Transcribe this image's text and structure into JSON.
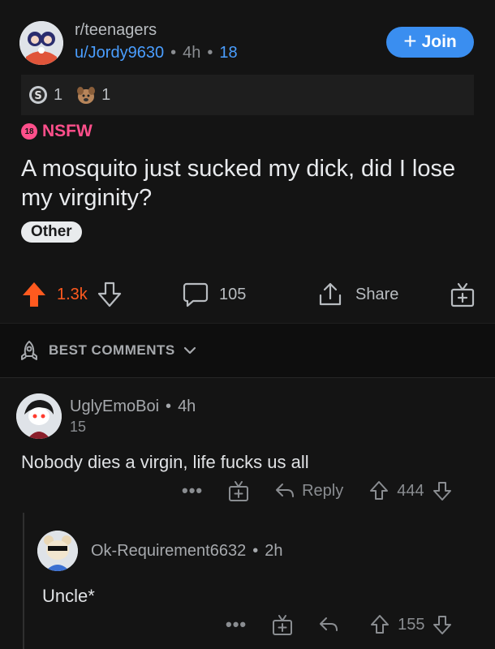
{
  "header": {
    "subreddit": "r/teenagers",
    "author": "u/Jordy9630",
    "age": "4h",
    "count": "18",
    "join_label": "Join"
  },
  "awards": [
    {
      "icon": "silver-award-icon",
      "count": "1"
    },
    {
      "icon": "dog-award-icon",
      "count": "1"
    }
  ],
  "post": {
    "nsfw_badge": "18",
    "nsfw_label": "NSFW",
    "title": "A mosquito just sucked my dick, did I lose my virginity?",
    "flair": "Other"
  },
  "actions": {
    "upvotes": "1.3k",
    "comments": "105",
    "share": "Share"
  },
  "sort": {
    "label": "BEST COMMENTS"
  },
  "comments": [
    {
      "user": "UglyEmoBoi",
      "age": "4h",
      "score": "15",
      "body": "Nobody dies a virgin, life fucks us all",
      "more": "•••",
      "reply": "Reply",
      "votes": "444"
    },
    {
      "user": "Ok-Requirement6632",
      "age": "2h",
      "body": "Uncle*",
      "more": "•••",
      "votes": "155"
    }
  ],
  "colors": {
    "background": "#141414",
    "accent": "#3a8ef0",
    "upvote": "#ff5a1f",
    "nsfw": "#ff4f8b"
  }
}
